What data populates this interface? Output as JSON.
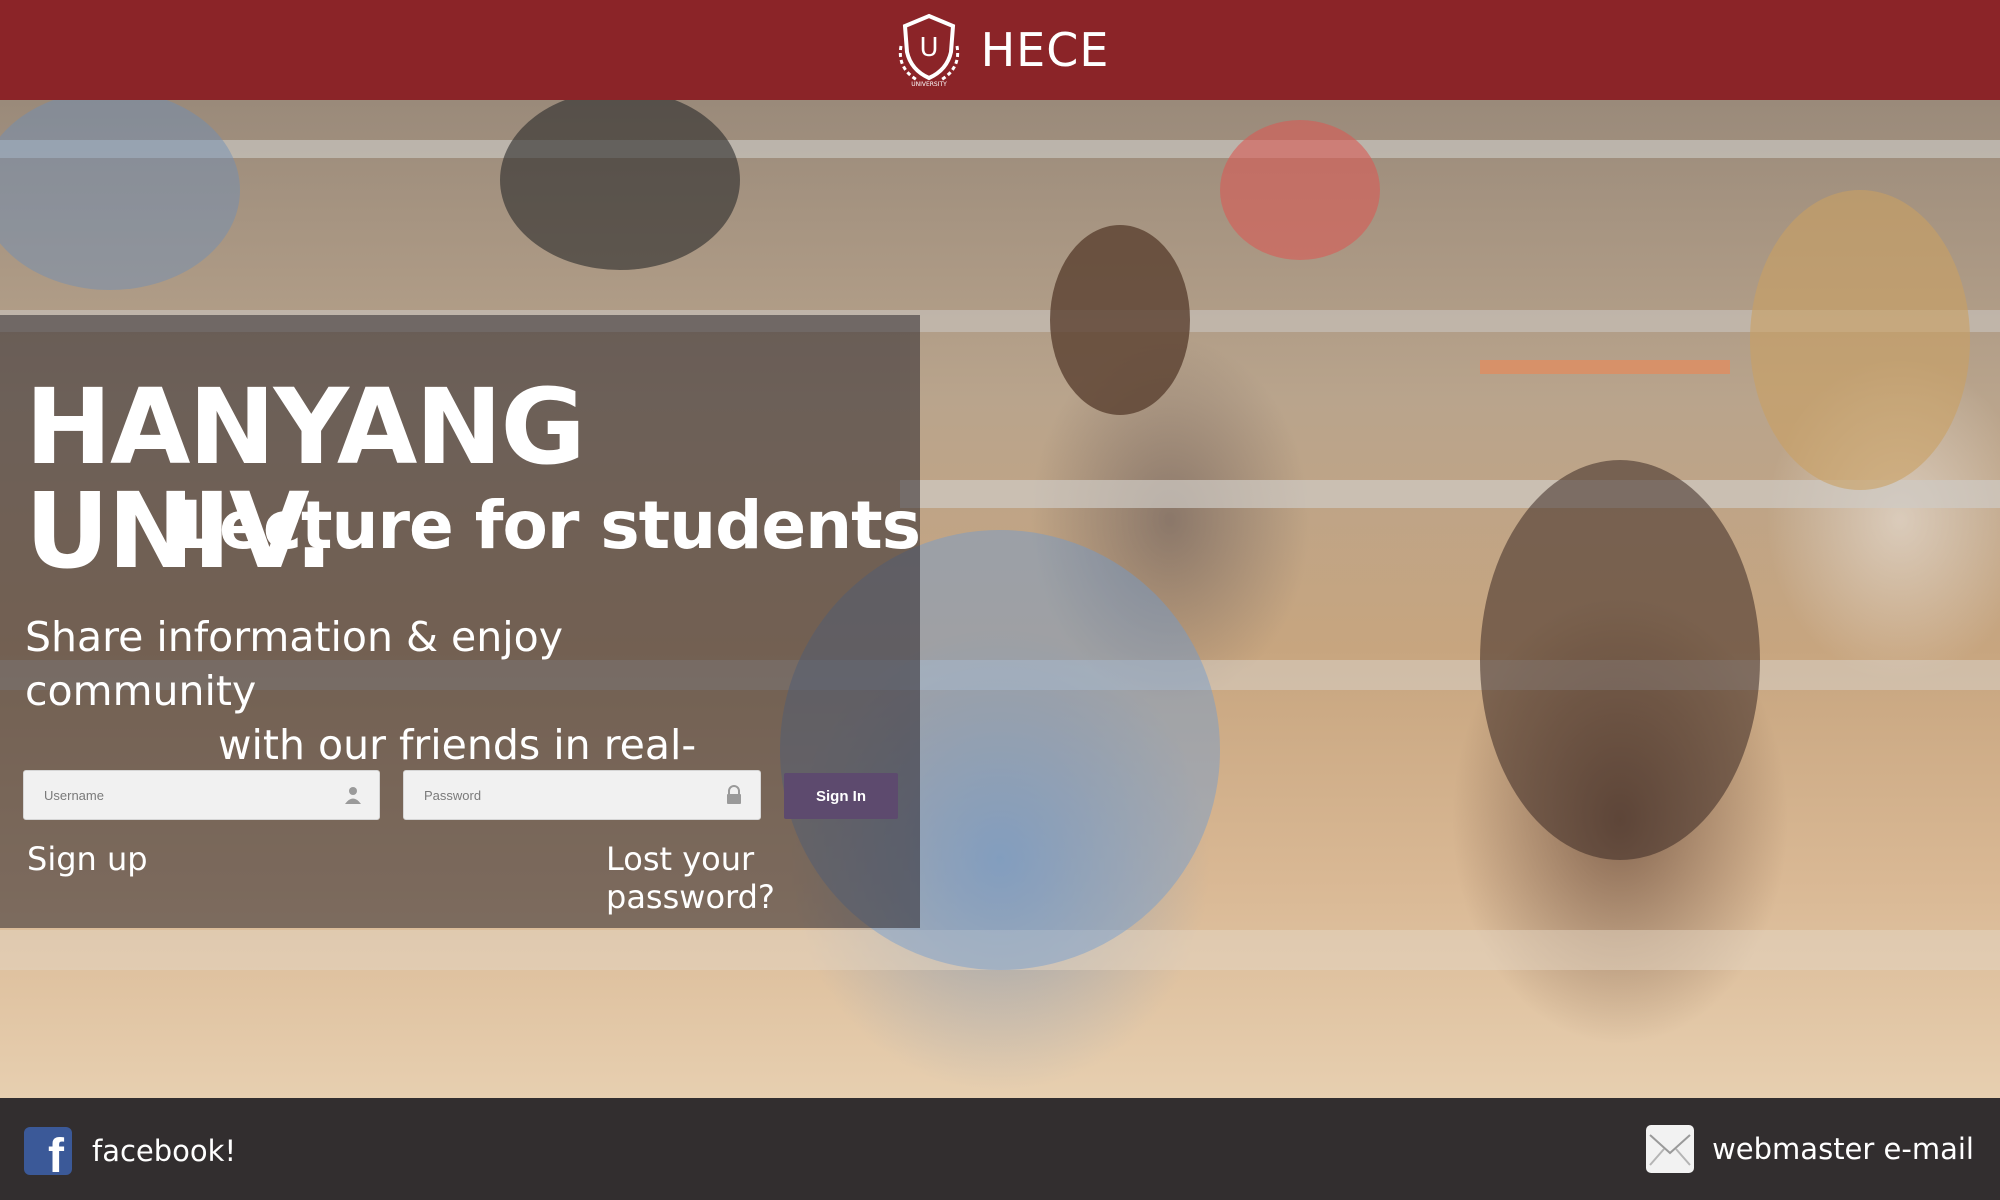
{
  "header": {
    "brand_name": "HECE",
    "logo_letter": "U",
    "logo_caption": "UNIVERSITY",
    "logo_icon": "shield-u-icon",
    "color": "#8b2428"
  },
  "hero": {
    "title": "HANYANG UNIV.",
    "subtitle": "Lecture for students",
    "tagline_line1": "Share information & enjoy community",
    "tagline_line2": "with our friends in real-time"
  },
  "login": {
    "username_placeholder": "Username",
    "username_icon": "user-icon",
    "password_placeholder": "Password",
    "password_icon": "lock-icon",
    "signin_label": "Sign In",
    "signup_label": "Sign up",
    "lost_password_label": "Lost your password?",
    "accent": "#5d4a6e"
  },
  "footer": {
    "facebook_label": "facebook!",
    "facebook_icon": "facebook-icon",
    "facebook_color": "#3b5998",
    "email_label": "webmaster e-mail",
    "email_icon": "mail-icon"
  }
}
